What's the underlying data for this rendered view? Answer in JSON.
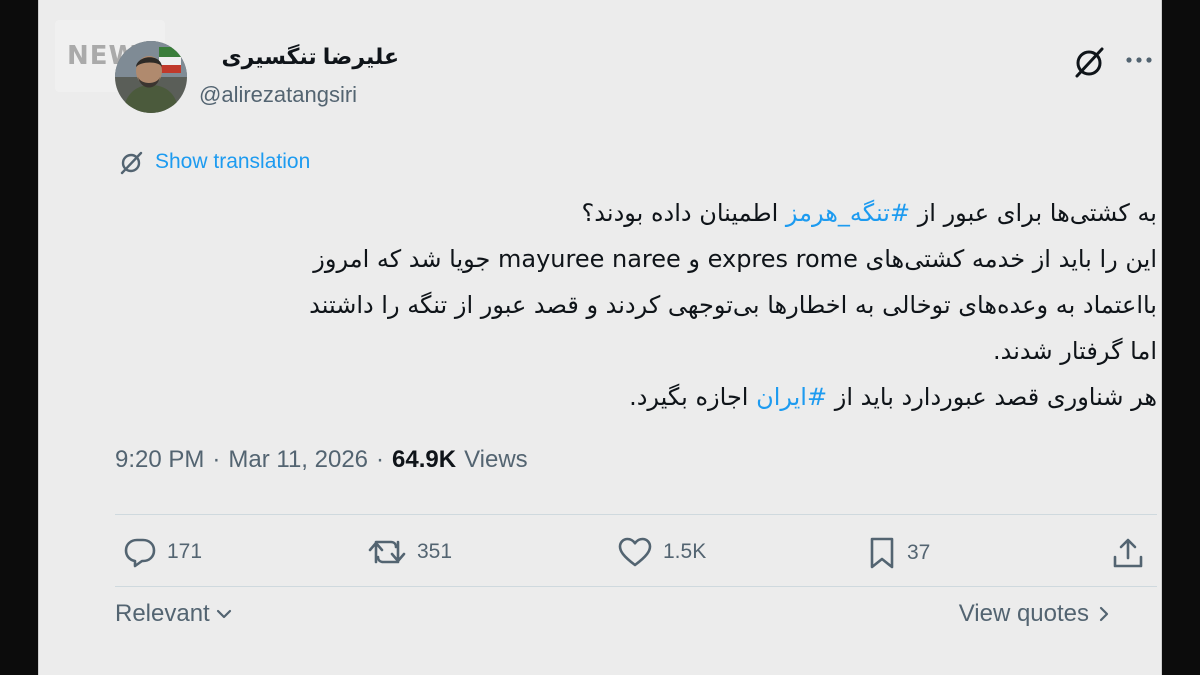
{
  "watermark": {
    "text": "NEWS"
  },
  "author": {
    "display_name": "علیرضا تنگسیری",
    "handle": "@alirezatangsiri"
  },
  "translation": {
    "label": "Show translation"
  },
  "tweet": {
    "line1_pre": "به کشتی‌ها برای عبور از ",
    "line1_tag": "#تنگه_هرمز",
    "line1_post": " اطمینان داده بودند؟",
    "line2": "این را باید از خدمه کشتی‌های expres rome و  mayuree naree جویا شد که امروز",
    "line3": "بااعتماد به وعده‌های توخالی به اخطارها بی‌توجهی کردند و قصد عبور از تنگه را داشتند",
    "line4": "اما گرفتار شدند.",
    "line5_pre": "هر شناوری قصد عبوردارد باید از ",
    "line5_tag": "#ایران",
    "line5_post": " اجازه بگیرد."
  },
  "meta": {
    "time": "9:20 PM",
    "sep1": "·",
    "date": "Mar 11, 2026",
    "sep2": "·",
    "views_count": "64.9K",
    "views_label": "Views"
  },
  "actions": {
    "replies": "171",
    "reposts": "351",
    "likes": "1.5K",
    "bookmarks": "37"
  },
  "footer": {
    "sort_label": "Relevant",
    "quotes_label": "View quotes"
  },
  "icons": [
    "grok-icon",
    "more-icon",
    "translate-icon",
    "reply-icon",
    "repost-icon",
    "like-icon",
    "bookmark-icon",
    "share-icon",
    "chevron-down-icon",
    "chevron-right-icon"
  ],
  "colors": {
    "link": "#1d9bf0",
    "text": "#0f1419",
    "muted": "#536471",
    "background": "#ececec"
  }
}
